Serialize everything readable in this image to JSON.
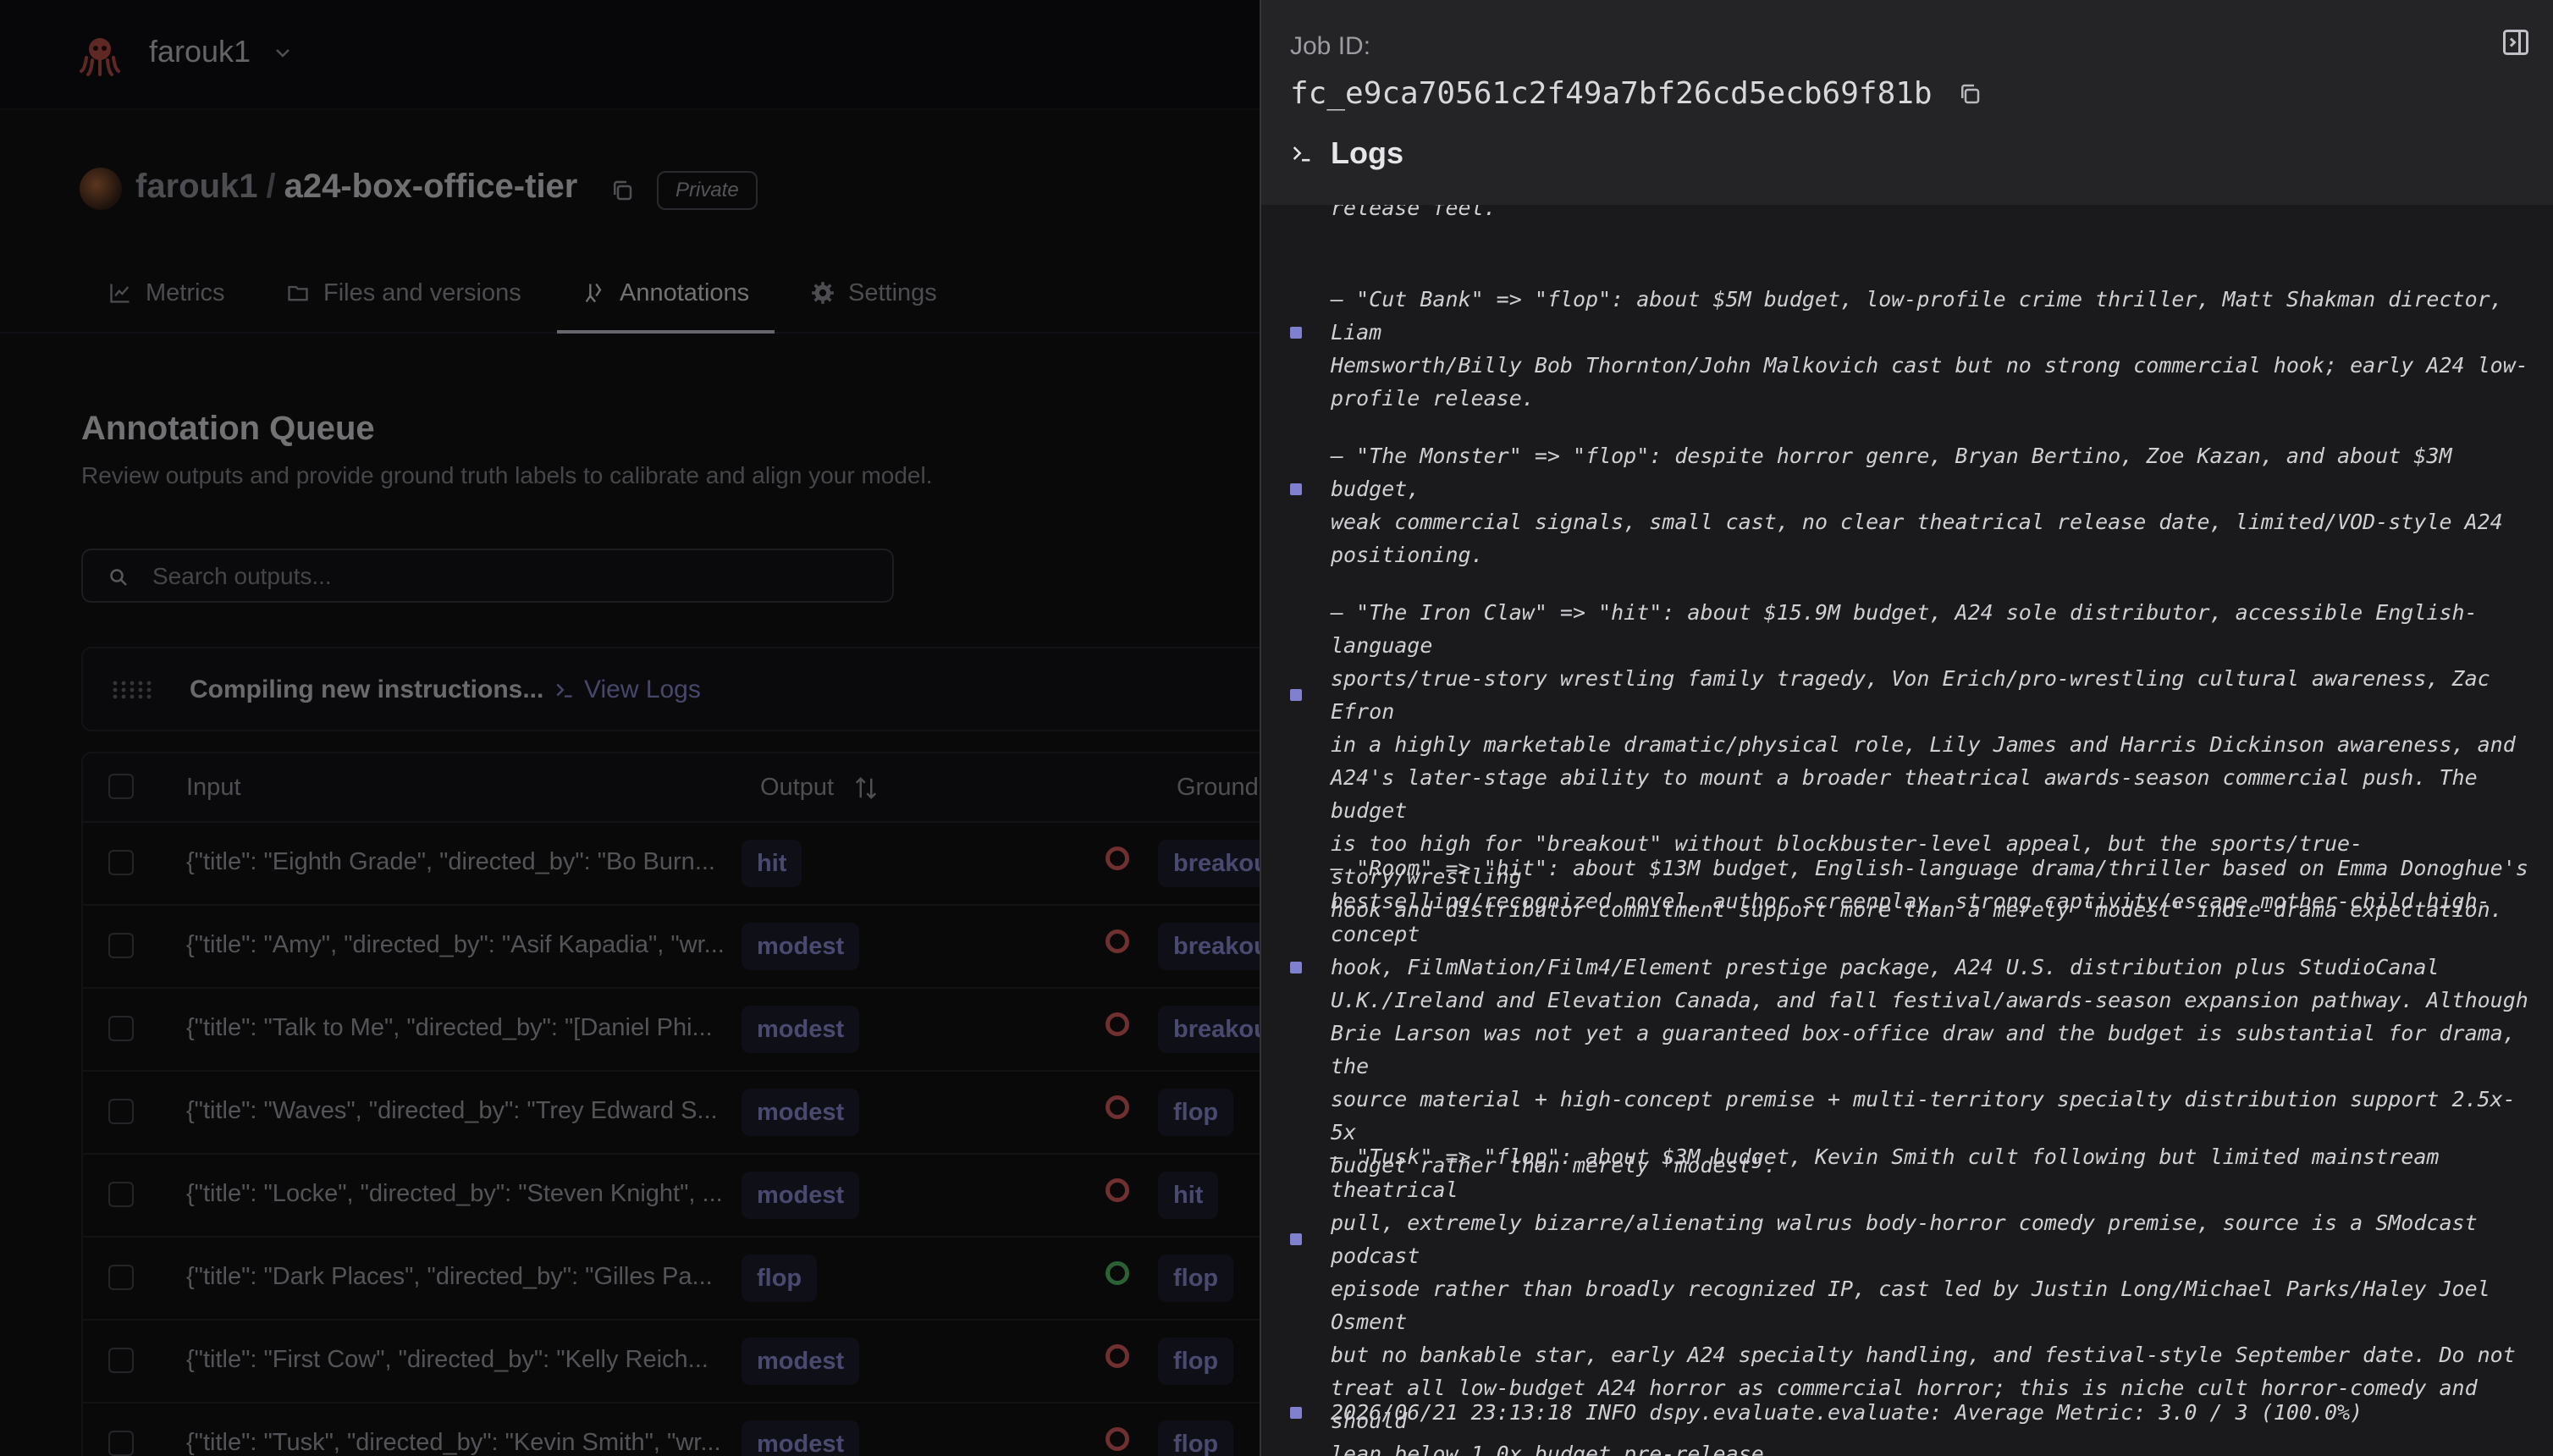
{
  "app": {
    "org_name": "farouk1",
    "repo_owner": "farouk1",
    "repo_separator": "/",
    "repo_name": "a24-box-office-tier",
    "visibility_badge": "Private",
    "tabs": [
      {
        "label": "Metrics",
        "icon": "chart-icon",
        "active": false
      },
      {
        "label": "Files and versions",
        "icon": "folder-icon",
        "active": false
      },
      {
        "label": "Annotations",
        "icon": "annotations-icon",
        "active": true
      },
      {
        "label": "Settings",
        "icon": "gear-icon",
        "active": false
      }
    ],
    "queue_title": "Annotation Queue",
    "queue_subtitle": "Review outputs and provide ground truth labels to calibrate and align your model.",
    "search_placeholder": "Search outputs...",
    "compiling_text": "Compiling new instructions...",
    "view_logs_label": "View Logs",
    "table": {
      "headers": {
        "input": "Input",
        "output": "Output",
        "ground_truth": "Ground"
      },
      "rows": [
        {
          "input": "{\"title\": \"Eighth Grade\", \"directed_by\": \"Bo Burn...",
          "output": "hit",
          "match": false,
          "ground_truth": "breakou"
        },
        {
          "input": "{\"title\": \"Amy\", \"directed_by\": \"Asif Kapadia\", \"wr...",
          "output": "modest",
          "match": false,
          "ground_truth": "breakou"
        },
        {
          "input": "{\"title\": \"Talk to Me\", \"directed_by\": \"[Daniel Phi...",
          "output": "modest",
          "match": false,
          "ground_truth": "breakou"
        },
        {
          "input": "{\"title\": \"Waves\", \"directed_by\": \"Trey Edward S...",
          "output": "modest",
          "match": false,
          "ground_truth": "flop"
        },
        {
          "input": "{\"title\": \"Locke\", \"directed_by\": \"Steven Knight\", ...",
          "output": "modest",
          "match": false,
          "ground_truth": "hit"
        },
        {
          "input": "{\"title\": \"Dark Places\", \"directed_by\": \"Gilles Pa...",
          "output": "flop",
          "match": true,
          "ground_truth": "flop"
        },
        {
          "input": "{\"title\": \"First Cow\", \"directed_by\": \"Kelly Reich...",
          "output": "modest",
          "match": false,
          "ground_truth": "flop"
        },
        {
          "input": "{\"title\": \"Tusk\", \"directed_by\": \"Kevin Smith\", \"wr...",
          "output": "modest",
          "match": false,
          "ground_truth": "flop"
        }
      ]
    }
  },
  "panel": {
    "job_id_label": "Job ID:",
    "job_id": "fc_e9ca70561c2f49a7bf26cd5ecb69f81b",
    "logs_title": "Logs",
    "log_cut_top": "release feel.",
    "log_entries": [
      "– \"Cut Bank\" => \"flop\": about $5M budget, low-profile crime thriller, Matt Shakman director, Liam\nHemsworth/Billy Bob Thornton/John Malkovich cast but no strong commercial hook; early A24 low-\nprofile release.",
      "– \"The Monster\" => \"flop\": despite horror genre, Bryan Bertino, Zoe Kazan, and about $3M budget,\nweak commercial signals, small cast, no clear theatrical release date, limited/VOD-style A24\npositioning.",
      "– \"The Iron Claw\" => \"hit\": about $15.9M budget, A24 sole distributor, accessible English-language\nsports/true-story wrestling family tragedy, Von Erich/pro-wrestling cultural awareness, Zac Efron\nin a highly marketable dramatic/physical role, Lily James and Harris Dickinson awareness, and\nA24's later-stage ability to mount a broader theatrical awards-season commercial push. The budget\nis too high for \"breakout\" without blockbuster-level appeal, but the sports/true-story/wrestling\nhook and distributor commitment support more than a merely \"modest\" indie-drama expectation.",
      "– \"Room\" => \"hit\": about $13M budget, English-language drama/thriller based on Emma Donoghue's\nbestselling/recognized novel, author screenplay, strong captivity/escape mother-child high-concept\nhook, FilmNation/Film4/Element prestige package, A24 U.S. distribution plus StudioCanal\nU.K./Ireland and Elevation Canada, and fall festival/awards-season expansion pathway. Although\nBrie Larson was not yet a guaranteed box-office draw and the budget is substantial for drama, the\nsource material + high-concept premise + multi-territory specialty distribution support 2.5x-5x\nbudget rather than merely \"modest\".",
      "– \"Tusk\" => \"flop\": about $3M budget, Kevin Smith cult following but limited mainstream theatrical\npull, extremely bizarre/alienating walrus body-horror comedy premise, source is a SModcast podcast\nepisode rather than broadly recognized IP, cast led by Justin Long/Michael Parks/Haley Joel Osment\nbut no bankable star, early A24 specialty handling, and festival-style September date. Do not\ntreat all low-budget A24 horror as commercial horror; this is niche cult horror-comedy and should\nlean below 1.0x budget pre-release.",
      "2026/06/21 23:13:18 INFO dspy.evaluate.evaluate: Average Metric: 3.0 / 3 (100.0%)"
    ]
  },
  "colors": {
    "accent": "#9494e0",
    "mismatch": "#e06060",
    "match": "#54c46c",
    "log_marker": "#8080d0"
  }
}
